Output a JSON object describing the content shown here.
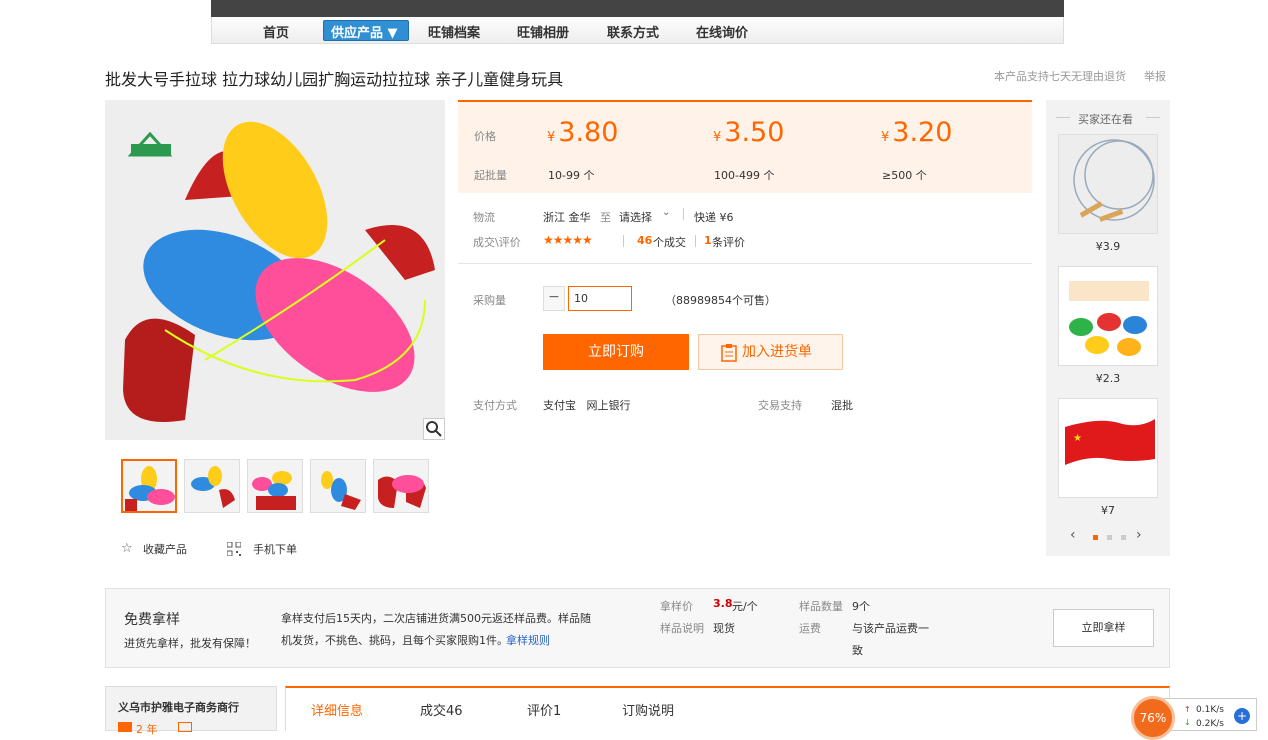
{
  "nav": {
    "items": [
      "首页",
      "旺铺档案",
      "旺铺相册",
      "联系方式",
      "在线询价"
    ],
    "active": "供应产品 ▼"
  },
  "product": {
    "title": "批发大号手拉球 拉力球幼儿园扩胸运动拉拉球 亲子儿童健身玩具",
    "return_note": "本产品支持七天无理由退货",
    "report": "举报"
  },
  "pricing": {
    "price_label": "价格",
    "moq_label": "起批量",
    "currency": "¥",
    "tiers": [
      {
        "price": "3.80",
        "moq": "10-99 个"
      },
      {
        "price": "3.50",
        "moq": "100-499 个"
      },
      {
        "price": "3.20",
        "moq": "≥500 个"
      }
    ]
  },
  "logistics": {
    "label": "物流",
    "from": "浙江 金华",
    "to_word": "至",
    "select": "请选择",
    "express": "快递 ¥6"
  },
  "deals": {
    "label": "成交\\评价",
    "stars": "★★★★★",
    "deal_count": "46",
    "deal_suffix": "个成交",
    "review_count": "1",
    "review_suffix": "条评价"
  },
  "purchase": {
    "qty_label": "采购量",
    "minus": "−",
    "qty_value": "10",
    "available": "（88989854个可售）",
    "order_button": "立即订购",
    "cart_button": "加入进货单"
  },
  "payment": {
    "label": "支付方式",
    "methods": "支付宝   网上银行",
    "support_label": "交易支持",
    "support_value": "混批"
  },
  "actions": {
    "favorite": "收藏产品",
    "mobile": "手机下单"
  },
  "side": {
    "title": "买家还在看",
    "items": [
      {
        "price": "¥3.9"
      },
      {
        "price": "¥2.3"
      },
      {
        "price": "¥7"
      }
    ]
  },
  "sample": {
    "title": "免费拿样",
    "subtitle": "进货先拿样，批发有保障！",
    "desc1": "拿样支付后15天内，二次店铺进货满500元返还样品费。样品随",
    "desc2": "机发货，不挑色、挑码，且每个买家限购1件。",
    "rules_link": "拿样规则",
    "price_label": "拿样价",
    "price_value": "3.8",
    "price_unit": "元/个",
    "note_label": "样品说明",
    "note_value": "现货",
    "qty_label": "样品数量",
    "qty_value": "9个",
    "freight_label": "运费",
    "freight_value1": "与该产品运费一",
    "freight_value2": "致",
    "button": "立即拿样"
  },
  "shop": {
    "name": "义乌市护雅电子商务商行",
    "years": "2 年"
  },
  "tabs": [
    "详细信息",
    "成交46",
    "评价1",
    "订购说明"
  ],
  "widget": {
    "percent": "76%",
    "up": "0.1K/s",
    "down": "0.2K/s"
  },
  "colors": {
    "accent": "#ff6600",
    "nav_active": "#2f8fd2"
  }
}
